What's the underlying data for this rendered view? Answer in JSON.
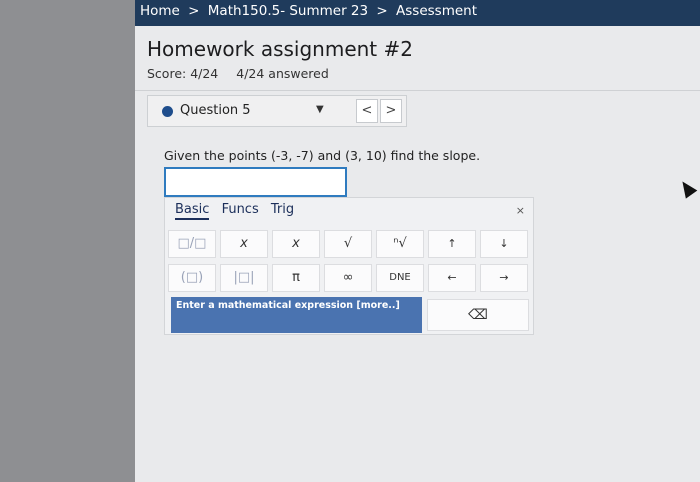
{
  "breadcrumb": {
    "home": "Home",
    "course": "Math150.5- Summer 23",
    "current": "Assessment",
    "separator": ">"
  },
  "assignment": {
    "title": "Homework assignment #2",
    "score": "Score: 4/24",
    "answered": "4/24 answered"
  },
  "question_nav": {
    "label": "Question 5",
    "dropdown_icon": "▼",
    "prev": "<",
    "next": ">"
  },
  "question": {
    "text": "Given the points (-3, -7) and (3, 10) find the slope.",
    "answer_value": ""
  },
  "palette": {
    "tabs": [
      "Basic",
      "Funcs",
      "Trig"
    ],
    "close": "×",
    "row1": [
      "□/□",
      "x",
      "x",
      "√",
      "ⁿ√",
      "↑",
      "↓"
    ],
    "row2": [
      "(□)",
      "|□|",
      "π",
      "∞",
      "DNE",
      "←",
      "→"
    ],
    "hint": "Enter a mathematical expression [more..]",
    "backspace": "⌫"
  }
}
